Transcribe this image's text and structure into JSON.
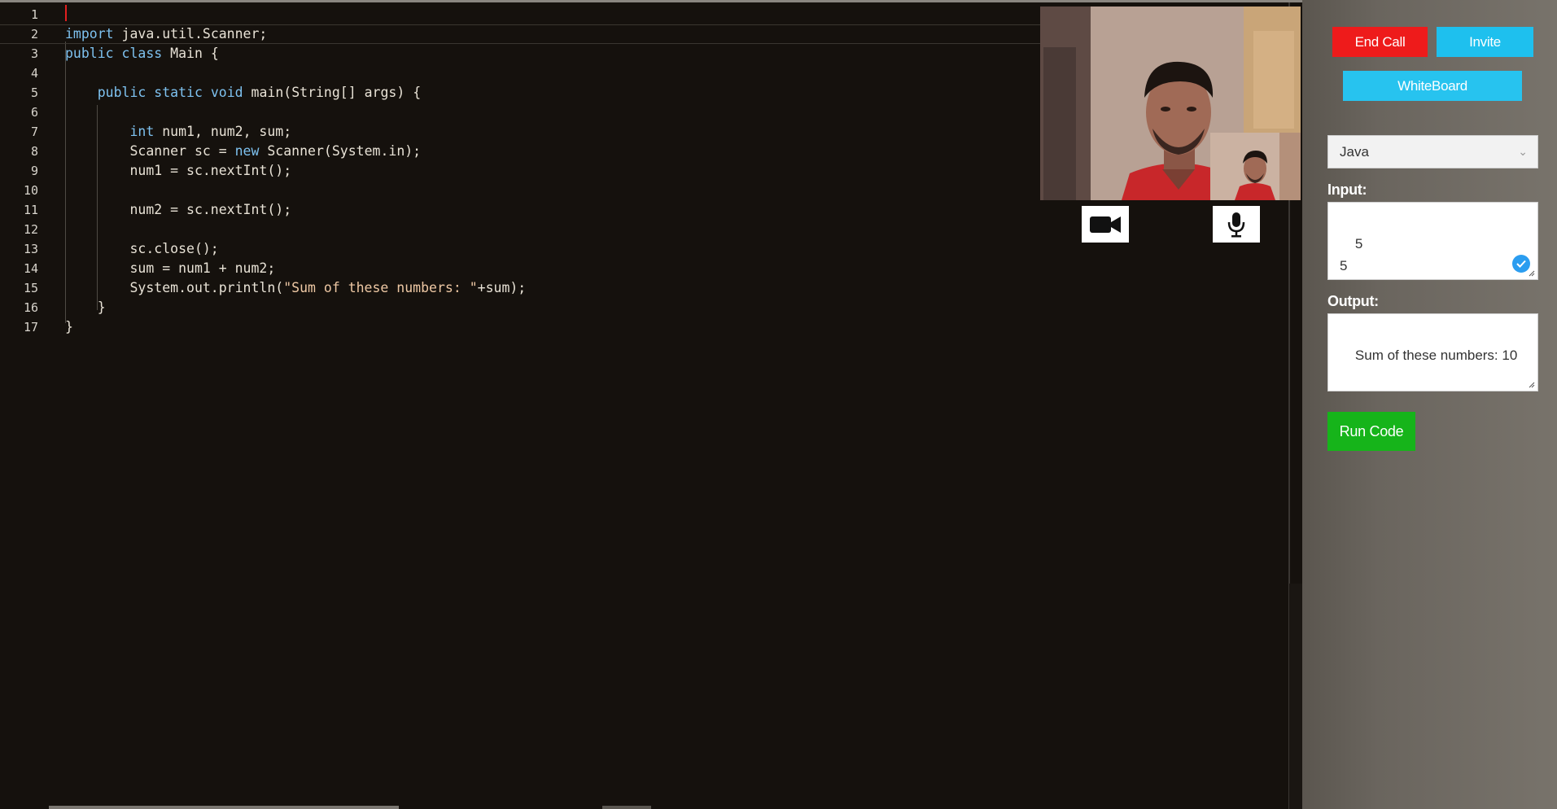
{
  "editor": {
    "lines": [
      {
        "n": "1",
        "text": ""
      },
      {
        "n": "2",
        "text": "import java.util.Scanner;"
      },
      {
        "n": "3",
        "text": "public class Main {"
      },
      {
        "n": "4",
        "text": ""
      },
      {
        "n": "5",
        "text": "    public static void main(String[] args) {"
      },
      {
        "n": "6",
        "text": ""
      },
      {
        "n": "7",
        "text": "        int num1, num2, sum;"
      },
      {
        "n": "8",
        "text": "        Scanner sc = new Scanner(System.in);"
      },
      {
        "n": "9",
        "text": "        num1 = sc.nextInt();"
      },
      {
        "n": "10",
        "text": ""
      },
      {
        "n": "11",
        "text": "        num2 = sc.nextInt();"
      },
      {
        "n": "12",
        "text": ""
      },
      {
        "n": "13",
        "text": "        sc.close();"
      },
      {
        "n": "14",
        "text": "        sum = num1 + num2;"
      },
      {
        "n": "15",
        "text": "        System.out.println(\"Sum of these numbers: \"+sum);"
      },
      {
        "n": "16",
        "text": "    }"
      },
      {
        "n": "17",
        "text": "}"
      }
    ],
    "keywords": [
      "import",
      "public",
      "class",
      "static",
      "void",
      "int",
      "new"
    ]
  },
  "video": {
    "camera_icon": "video-camera-icon",
    "mic_icon": "microphone-icon"
  },
  "panel": {
    "end_call_label": "End Call",
    "invite_label": "Invite",
    "whiteboard_label": "WhiteBoard",
    "language_selected": "Java",
    "input_label": "Input:",
    "input_value": "5\n5",
    "output_label": "Output:",
    "output_value": "Sum of these numbers: 10",
    "run_label": "Run Code"
  },
  "colors": {
    "end_call": "#ee1b1b",
    "invite": "#1ec0ee",
    "whiteboard": "#27c3ef",
    "run": "#16b41a",
    "editor_bg": "#15110d",
    "keyword": "#7ec2f0",
    "string": "#eec8a4"
  }
}
